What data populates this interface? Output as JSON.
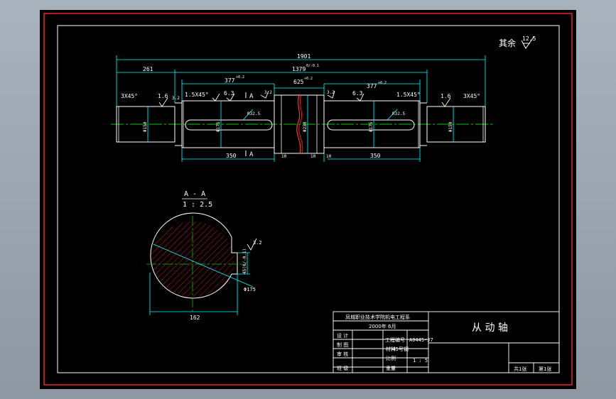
{
  "colors": {
    "background": "#000000",
    "outer_frame": "#e8242b",
    "inner_frame": "#ffffff",
    "outline": "#ffffff",
    "dimension": "#00ffff",
    "centerline": "#00c800",
    "hatch": "#ff2020",
    "annotation_white": "#ffffff"
  },
  "drawing": {
    "roughness_note": {
      "label": "其余",
      "value": "12.5"
    },
    "dims": {
      "overall_length": "1901",
      "left_offset": "261",
      "inner_span": "1379",
      "inner_span_tol": "0/-0.1",
      "mid_width": "625",
      "mid_width_tol": "+0.2",
      "keyway_left_len": "377",
      "keyway_left_tol": "+0.2",
      "keyway_right_len": "377",
      "keyway_right_tol": "+0.2",
      "chamfer_left": "3X45°",
      "chamfer_right": "3X45°",
      "chamfer_step_left": "1.5X45°",
      "chamfer_step_right": "1.5X45°",
      "rough_16_left": "1.6",
      "rough_16_right": "1.6",
      "rough_63_left": "6.3",
      "rough_63_right": "6.3",
      "rough_32_left": "3.2",
      "rough_32_mid_left": "3.2",
      "rough_32_mid_right": "3.2",
      "section_mark_top": "A",
      "section_mark_bottom": "A",
      "dia_end_left": "Φ150",
      "dia_end_right": "Φ150",
      "dia_mid_left": "Φ175",
      "dia_mid_right": "Φ175",
      "dia_collar": "Φ230",
      "radius_left": "R32.5",
      "radius_right": "R32.5",
      "key_len_left": "350",
      "key_len_right": "350",
      "shoulder_left": "10",
      "shoulder_mid": "10",
      "shoulder_right": "10"
    },
    "section": {
      "title": "A - A",
      "scale": "1 : 2.5",
      "dia": "Φ175",
      "keyway_depth": "45(0/-0.1)",
      "width": "162",
      "rough": "3.2"
    }
  },
  "title_block": {
    "school": "凤城职业技术学院机电工程系",
    "date": "2000年 6月",
    "part_name": "从 动 轴",
    "row_labels": [
      "设 计",
      "制 图",
      "审 核",
      "班 级"
    ],
    "drawing_no_label": "工程编号",
    "drawing_no": "A0445-J7",
    "material_label": "材料",
    "material_value": "45号钢",
    "scale_label": "比例",
    "scale_value": "1 : 5",
    "weight_label": "重量",
    "sheet_label": "共1张",
    "sheet_no": "第1张"
  }
}
